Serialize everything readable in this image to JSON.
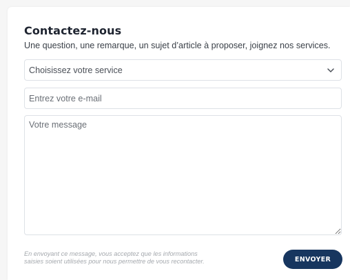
{
  "form": {
    "title": "Contactez-nous",
    "subtitle": "Une question, une remarque, un sujet d’article à proposer, joignez nos services.",
    "service_select": {
      "selected": "Choisissez votre service",
      "icon": "chevron-down-icon"
    },
    "email_placeholder": "Entrez votre e-mail",
    "message_placeholder": "Votre message",
    "disclaimer_line1": "En envoyant ce message, vous acceptez que les informations",
    "disclaimer_line2": "saisies soient utilisées pour nous permettre de vous recontacter.",
    "submit_label": "ENVOYER",
    "colors": {
      "button": "#17365f",
      "title": "#1e2430",
      "disclaimer": "#a5a9ae"
    }
  }
}
